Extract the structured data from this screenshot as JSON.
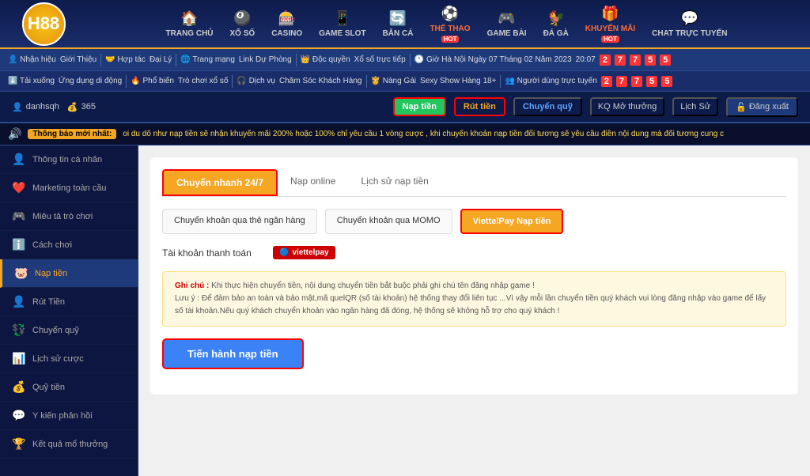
{
  "header": {
    "logo_text": "H88",
    "nav_items": [
      {
        "id": "trang-chu",
        "icon": "🏠",
        "label": "TRANG CHỦ",
        "hot": false
      },
      {
        "id": "xo-so",
        "icon": "🎱",
        "label": "XỔ SỐ",
        "hot": false
      },
      {
        "id": "casino",
        "icon": "🎰",
        "label": "CASINO",
        "hot": false
      },
      {
        "id": "game-slot",
        "icon": "📱",
        "label": "GAME SLOT",
        "hot": false
      },
      {
        "id": "ban-ca",
        "icon": "🔄",
        "label": "BẮN CÁ",
        "hot": false
      },
      {
        "id": "the-thao",
        "icon": "⚽",
        "label": "THỂ THAO",
        "hot": true
      },
      {
        "id": "game-bai",
        "icon": "🎮",
        "label": "GAME BÀI",
        "hot": false
      },
      {
        "id": "da-ga",
        "icon": "🐓",
        "label": "ĐÁ GÀ",
        "hot": false
      },
      {
        "id": "khuyen-mai",
        "icon": "🎁",
        "label": "KHUYẾN MÃI",
        "hot": true
      },
      {
        "id": "chat-truc",
        "icon": "💬",
        "label": "CHAT TRỰC TUYẾN",
        "hot": false
      }
    ]
  },
  "sub_header": {
    "items_row1": [
      "👤 Nhận hiệu",
      "Giới Thiệu",
      "🤝 Hợp tác",
      "Đại Lý",
      "🌐 Trang mạng",
      "Link Dự Phòng",
      "👑 Độc quyền",
      "Xổ số trực tiếp",
      "🕐 Giờ Hà Nội",
      "Ngày 07 Tháng 02 Năm 2023",
      "20:07"
    ],
    "time_digits": [
      "2",
      "7",
      "7",
      "5",
      "5"
    ],
    "items_row2": [
      "⬇️ Tải xuống",
      "Ứng dụng di động",
      "🔥 Phổ biến",
      "Trò chơi xổ số",
      "🎧 Dịch vụ",
      "Chăm Sóc Khách Hàng",
      "👸 Nàng Gái",
      "Sexy Show Hàng 18+",
      "👥 Người dùng trực tuyến",
      "2",
      "7",
      "7",
      "5",
      "5"
    ]
  },
  "user_bar": {
    "username": "danhsqh",
    "balance": "365",
    "btn_naptien": "Nạp tiền",
    "btn_ruttien": "Rút tiền",
    "btn_chuyenquy": "Chuyển quỹ",
    "btn_mo_thuong": "KQ Mở thưởng",
    "btn_lich_su": "Lịch Sử",
    "btn_dang_xuat": "Đăng xuất"
  },
  "ticker": {
    "label": "Thông báo mới nhất:",
    "text": "oi du dỗ như nạp tiền sẽ nhận khuyến mãi 200% hoặc 100% chỉ yêu cầu 1 vòng cược , khi chuyển khoản nạp tiền đổi tương sẽ yêu cầu điền nội dung mà đổi tương cung c"
  },
  "sidebar": {
    "items": [
      {
        "id": "thong-tin",
        "icon": "👤",
        "label": "Thông tin cá nhân",
        "active": false
      },
      {
        "id": "marketing",
        "icon": "❤️",
        "label": "Marketing toàn cầu",
        "active": false
      },
      {
        "id": "mieu-ta",
        "icon": "🎮",
        "label": "Miêu tả trò chơi",
        "active": false
      },
      {
        "id": "cach-choi",
        "icon": "ℹ️",
        "label": "Cách chơi",
        "active": false
      },
      {
        "id": "nap-tien",
        "icon": "🐷",
        "label": "Nạp tiền",
        "active": true
      },
      {
        "id": "rut-tien",
        "icon": "👤",
        "label": "Rút Tiền",
        "active": false
      },
      {
        "id": "chuyen-quy",
        "icon": "💱",
        "label": "Chuyển quỹ",
        "active": false
      },
      {
        "id": "lich-su-cuoc",
        "icon": "📊",
        "label": "Lịch sử cược",
        "active": false
      },
      {
        "id": "quy-tien",
        "icon": "💰",
        "label": "Quỹ tiền",
        "active": false
      },
      {
        "id": "y-kien",
        "icon": "💬",
        "label": "Y kiến phản hồi",
        "active": false
      },
      {
        "id": "ket-qua",
        "icon": "🏆",
        "label": "Kết quả mổ thưởng",
        "active": false
      }
    ]
  },
  "content": {
    "tabs": [
      {
        "id": "chuyen-nhanh",
        "label": "Chuyển nhanh 24/7",
        "active": true
      },
      {
        "id": "nap-online",
        "label": "Nạp online",
        "active": false
      },
      {
        "id": "lich-su-nap",
        "label": "Lịch sử nạp tiền",
        "active": false
      }
    ],
    "payment_tabs": [
      {
        "id": "chuyen-khoan-ngan-hang",
        "label": "Chuyển khoản qua thẻ ngân hàng",
        "active": false
      },
      {
        "id": "chuyen-khoan-momo",
        "label": "Chuyển khoản qua MOMO",
        "active": false
      },
      {
        "id": "viettelpay",
        "label": "ViettelPay Nạp tiền",
        "active": true
      }
    ],
    "account_label": "Tài khoản thanh toán",
    "account_badge": "viettelpay",
    "note_title": "Ghi chú :",
    "note_text": "Khi thực hiện chuyển tiền, nội dung chuyển tiền bắt buộc phải ghi chú tên đăng nhập game !",
    "note_warning": "Lưu ý : Để đảm bảo an toàn và bảo mật,mã quelQR (số tài khoản) hệ thống thay đổi liên tục ...Vì vậy mỗi lần chuyển tiền quý khách vui lòng đăng nhập vào game để lấy số tài khoản.Nếu quý khách chuyển khoản vào ngân hàng đã đóng, hệ thống sẽ không hỗ trợ cho quý khách !",
    "cta_button": "Tiến hành nạp tiền"
  }
}
